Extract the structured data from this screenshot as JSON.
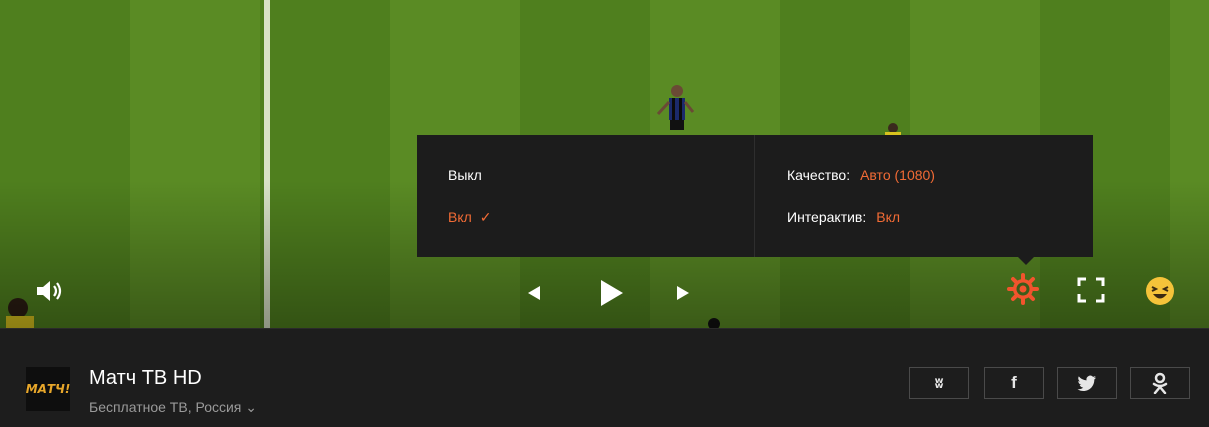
{
  "quality_menu": {
    "options": [
      {
        "label": "Выкл",
        "active": false
      },
      {
        "label": "Вкл",
        "active": true
      }
    ],
    "settings": [
      {
        "label": "Качество:",
        "value": "Авто (1080)"
      },
      {
        "label": "Интерактив:",
        "value": "Вкл"
      }
    ]
  },
  "channel": {
    "logo_text": "МАТЧ!",
    "title": "Матч ТВ HD",
    "subtitle": "Бесплатное ТВ, Россия"
  },
  "share_buttons": [
    "vk-icon",
    "facebook-icon",
    "twitter-icon",
    "odnoklassniki-icon"
  ],
  "colors": {
    "accent": "#f26b35",
    "panel": "#1c1c1c",
    "bar": "#1d1d1d"
  }
}
